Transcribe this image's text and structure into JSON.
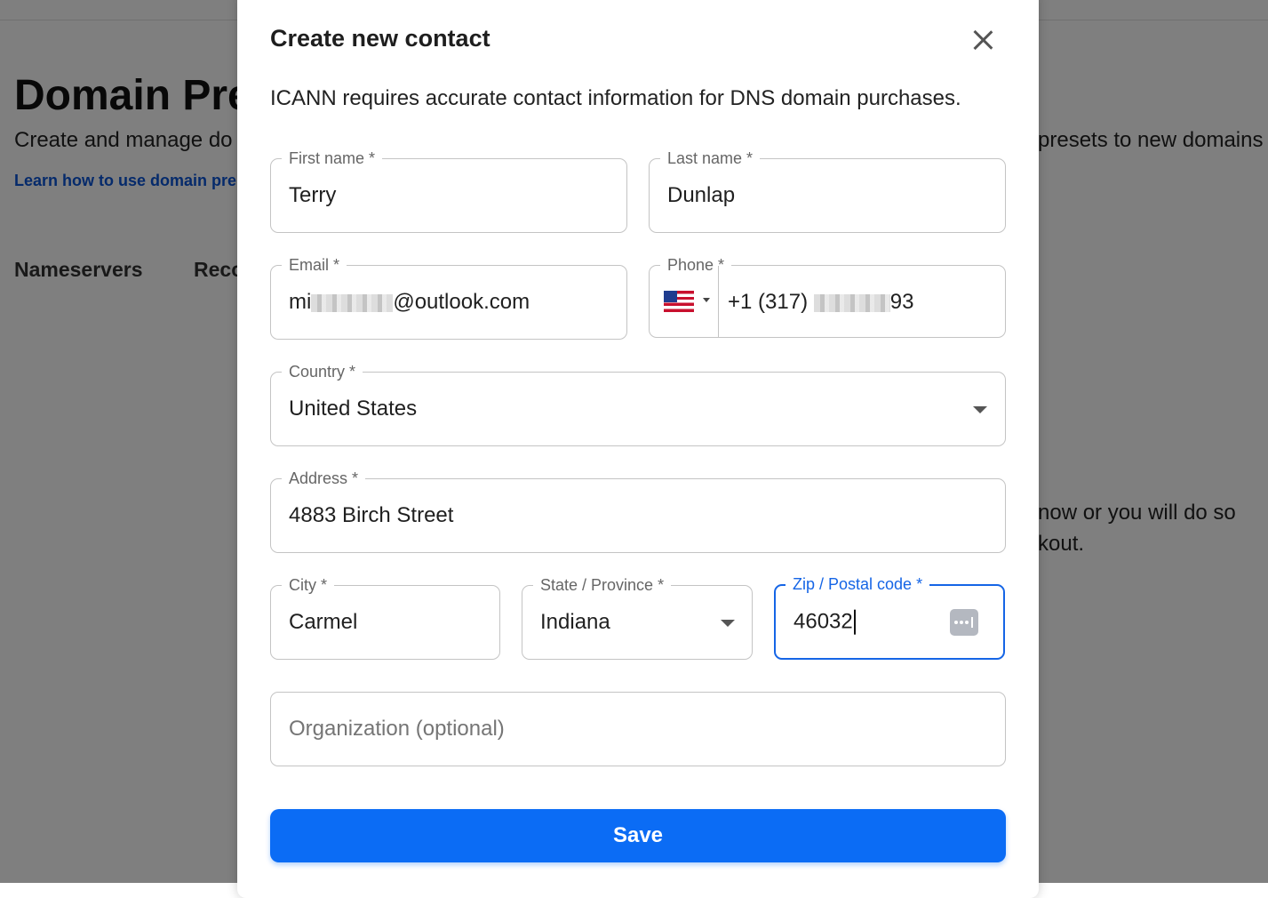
{
  "background": {
    "page_title": "Domain Pre",
    "subtitle_left": "Create and manage do",
    "subtitle_right": "presets to new domains",
    "learn_link": "Learn how to use domain pre",
    "tab_nameservers": "Nameservers",
    "tab_records": "Reco",
    "note_line1": "now or you will do so",
    "note_line2": "kout."
  },
  "modal": {
    "title": "Create new contact",
    "description": "ICANN requires accurate contact information for DNS domain purchases.",
    "close_icon": "close-icon",
    "fields": {
      "first_name": {
        "label": "First name *",
        "value": "Terry"
      },
      "last_name": {
        "label": "Last name *",
        "value": "Dunlap"
      },
      "email": {
        "label": "Email *",
        "value_prefix": "mi",
        "value_suffix": "@outlook.com"
      },
      "phone": {
        "label": "Phone *",
        "country_flag": "us-flag-icon",
        "value_prefix": "+1 (317) ",
        "value_suffix": "93"
      },
      "country": {
        "label": "Country *",
        "value": "United States"
      },
      "address": {
        "label": "Address *",
        "value": "4883 Birch Street"
      },
      "city": {
        "label": "City *",
        "value": "Carmel"
      },
      "state": {
        "label": "State / Province *",
        "value": "Indiana"
      },
      "zip": {
        "label": "Zip / Postal code *",
        "value": "46032"
      },
      "organization": {
        "placeholder": "Organization (optional)"
      }
    },
    "save_label": "Save"
  },
  "colors": {
    "accent": "#0b6cf5",
    "focus": "#1565e6",
    "overlay": "rgba(0,0,0,0.5)"
  }
}
